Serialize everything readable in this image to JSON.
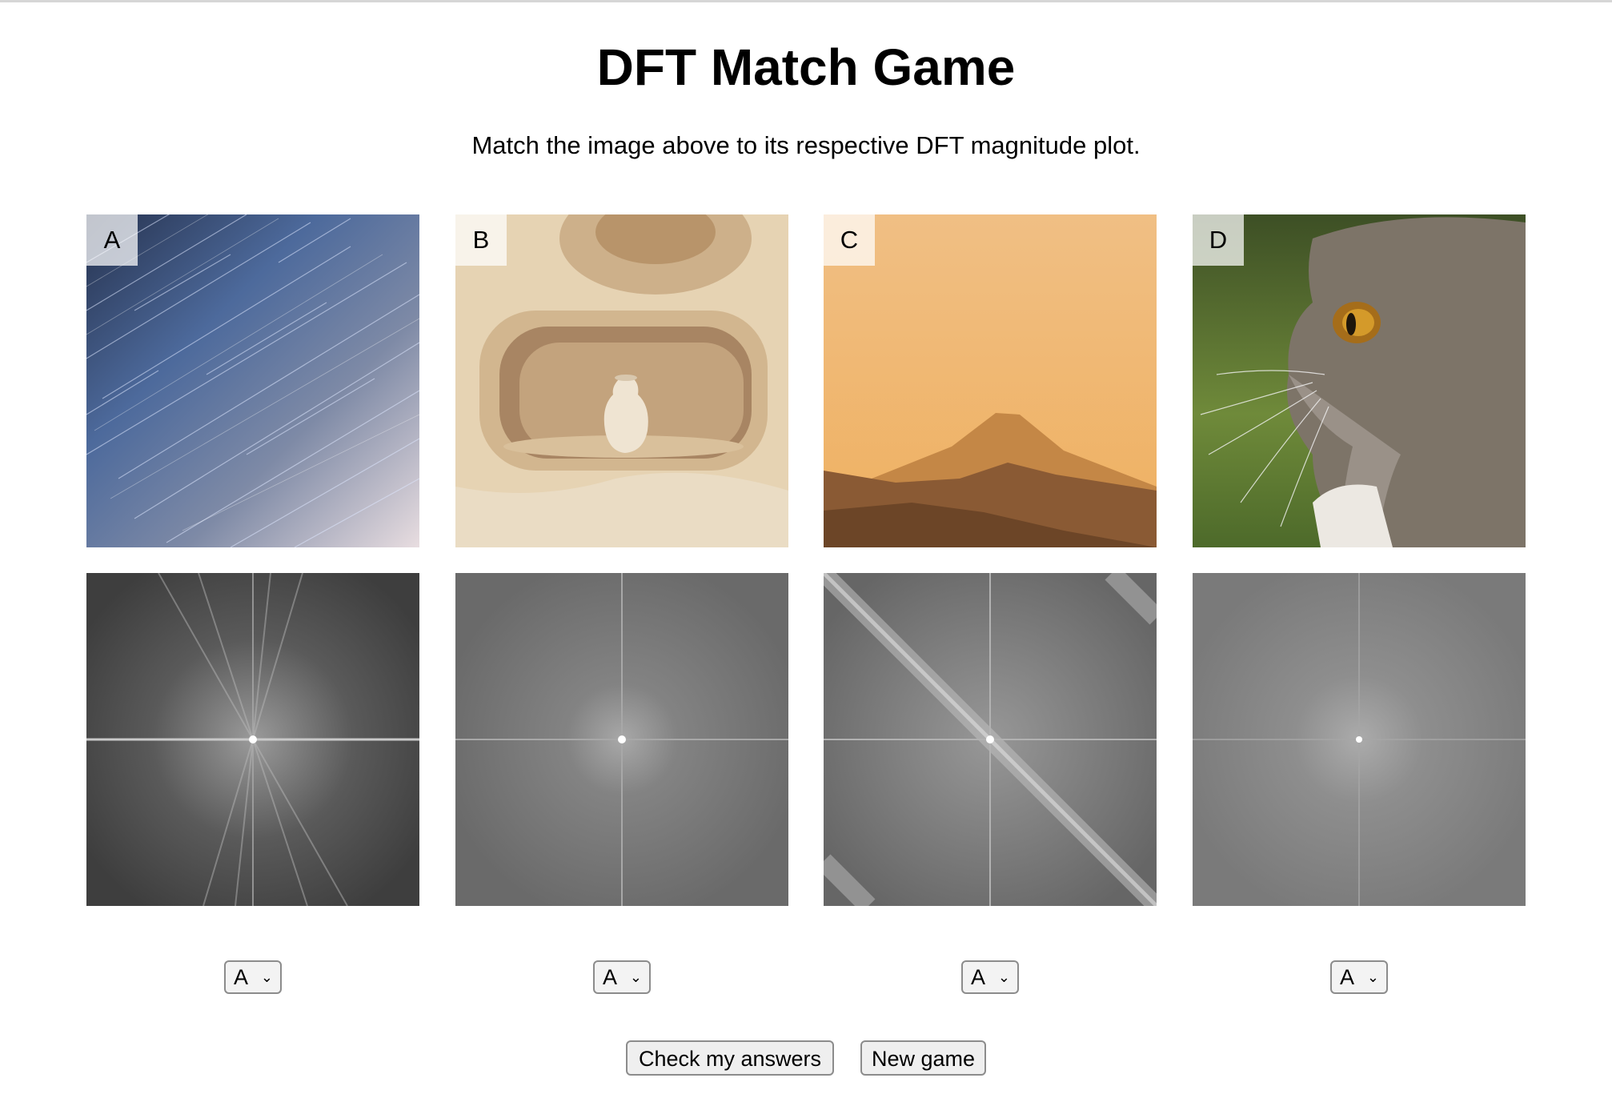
{
  "page": {
    "title": "DFT Match Game",
    "instructions": "Match the image above to its respective DFT magnitude plot."
  },
  "images": [
    {
      "letter": "A",
      "subject": "star trails night sky"
    },
    {
      "letter": "B",
      "subject": "clay niche with vase"
    },
    {
      "letter": "C",
      "subject": "mountain silhouette at sunset"
    },
    {
      "letter": "D",
      "subject": "grey cat profile"
    }
  ],
  "dft_plots": [
    {
      "subject": "dft-magnitude-plot",
      "selected": "A"
    },
    {
      "subject": "dft-magnitude-plot",
      "selected": "A"
    },
    {
      "subject": "dft-magnitude-plot",
      "selected": "A"
    },
    {
      "subject": "dft-magnitude-plot",
      "selected": "A"
    }
  ],
  "buttons": {
    "check": "Check my answers",
    "new_game": "New game"
  },
  "icons": {
    "dropdown": "chevron-down-icon"
  }
}
